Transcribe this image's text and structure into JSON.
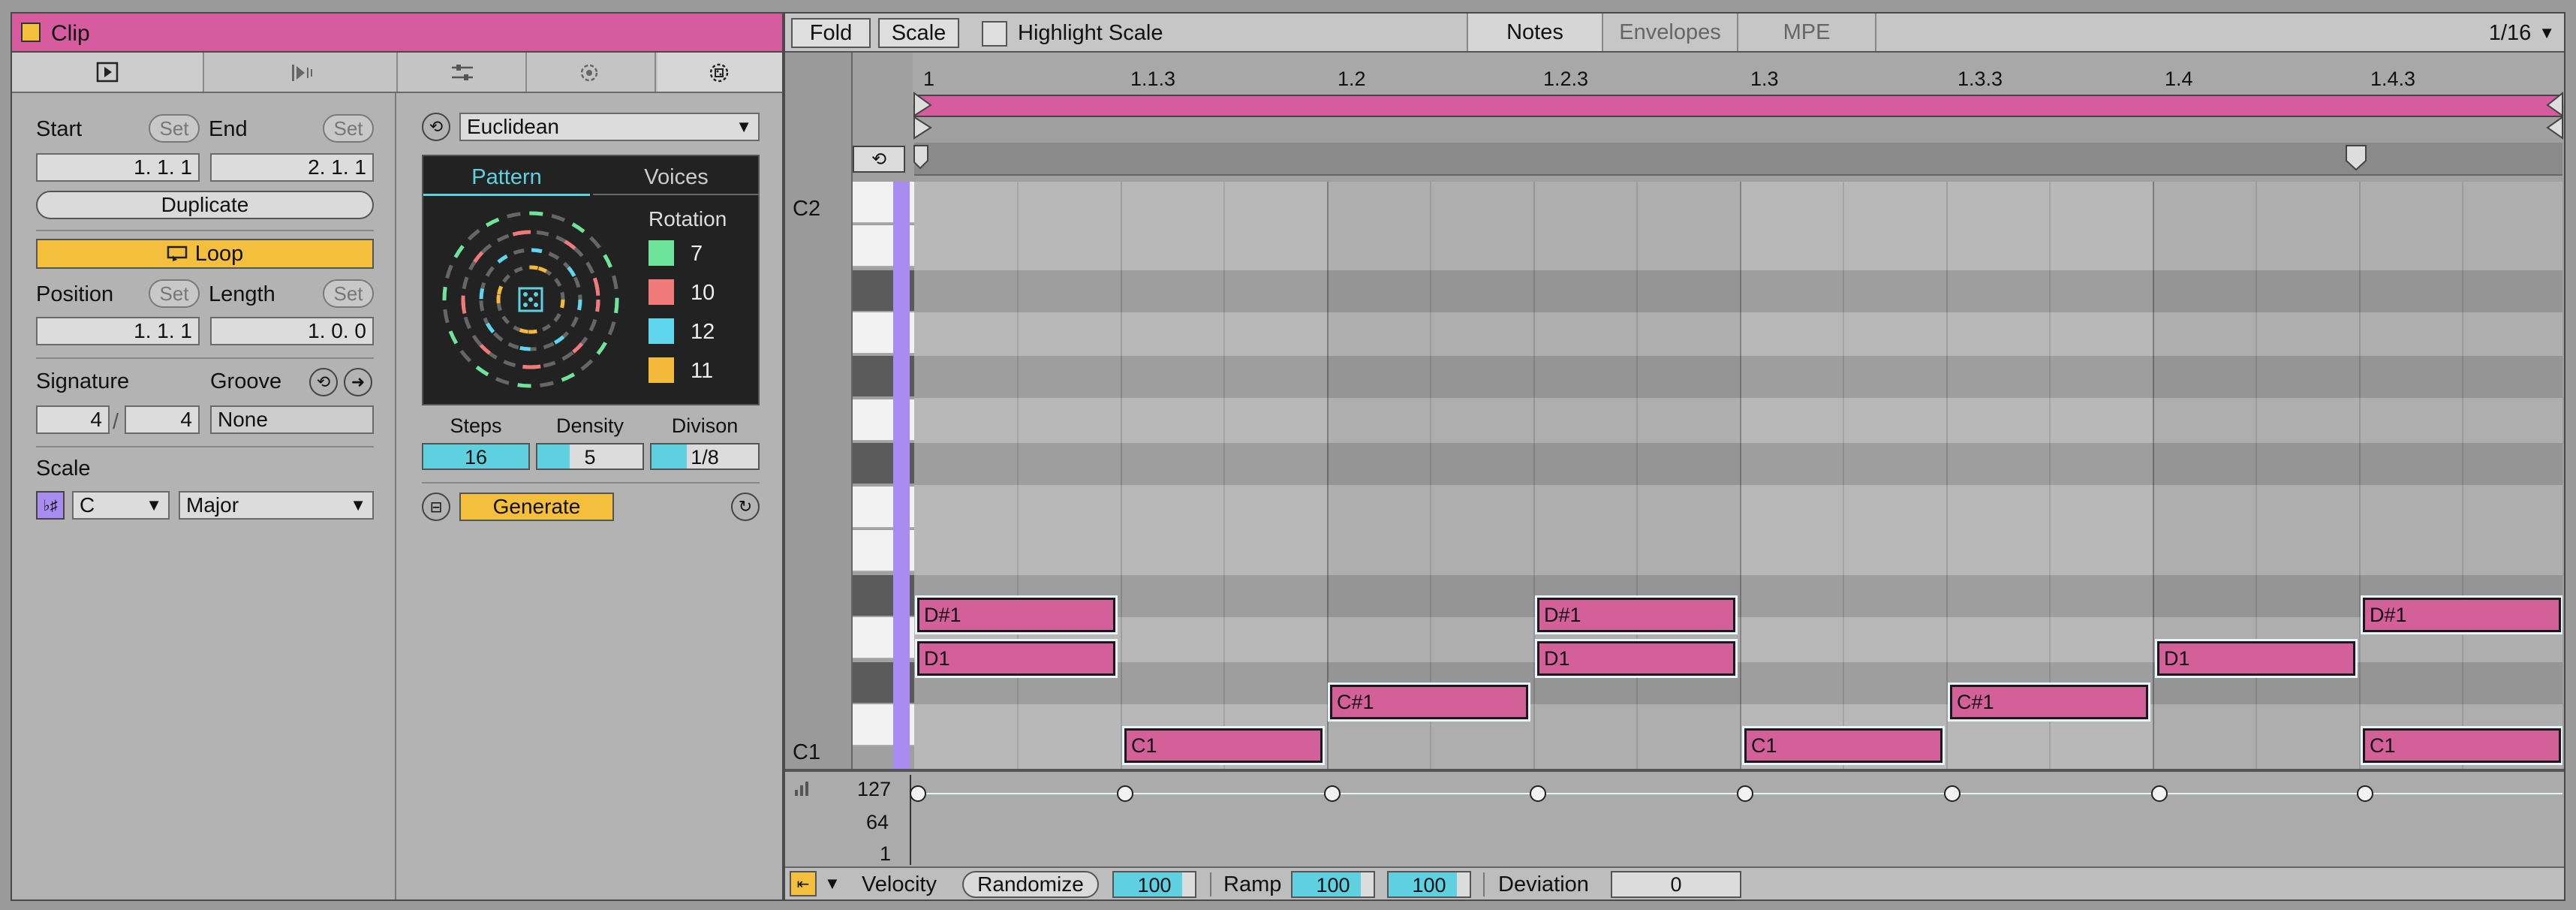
{
  "clip": {
    "title": "Clip",
    "start_label": "Start",
    "end_label": "End",
    "set": "Set",
    "start_value": "1.   1.   1",
    "end_value": "2.   1.   1",
    "duplicate": "Duplicate",
    "loop": "Loop",
    "position_label": "Position",
    "length_label": "Length",
    "position_value": "1.   1.   1",
    "length_value": "1.   0.   0",
    "signature_label": "Signature",
    "groove_label": "Groove",
    "sig_num": "4",
    "sig_den": "4",
    "groove_value": "None",
    "scale_label": "Scale",
    "scale_root": "C",
    "scale_mode": "Major"
  },
  "generator": {
    "type": "Euclidean",
    "tab_pattern": "Pattern",
    "tab_voices": "Voices",
    "rotation_label": "Rotation",
    "rotations": [
      {
        "value": "7",
        "color": "#6ee39a"
      },
      {
        "value": "10",
        "color": "#f07a7a"
      },
      {
        "value": "12",
        "color": "#5fd6ee"
      },
      {
        "value": "11",
        "color": "#f4b83a"
      }
    ],
    "steps_label": "Steps",
    "density_label": "Density",
    "division_label": "Divison",
    "steps_value": "16",
    "density_value": "5",
    "division_value": "1/8",
    "steps_fraction": 1.0,
    "density_fraction": 0.31,
    "division_fraction": 0.33,
    "generate": "Generate"
  },
  "toolbar": {
    "fold": "Fold",
    "scale": "Scale",
    "highlight_scale": "Highlight Scale",
    "tab_notes": "Notes",
    "tab_envelopes": "Envelopes",
    "tab_mpe": "MPE",
    "grid": "1/16"
  },
  "ruler": [
    "1",
    "1.1.3",
    "1.2",
    "1.2.3",
    "1.3",
    "1.3.3",
    "1.4",
    "1.4.3"
  ],
  "keys": {
    "top": "C2",
    "bottom": "C1"
  },
  "notes": [
    {
      "label": "D#1"
    },
    {
      "label": "D#1"
    },
    {
      "label": "D#1"
    },
    {
      "label": "D1"
    },
    {
      "label": "D1"
    },
    {
      "label": "D1"
    },
    {
      "label": "C#1"
    },
    {
      "label": "C#1"
    },
    {
      "label": "C1"
    },
    {
      "label": "C1"
    },
    {
      "label": "C1"
    }
  ],
  "velocity_lane": {
    "max": "127",
    "mid": "64",
    "min": "1"
  },
  "bottom": {
    "velocity_label": "Velocity",
    "randomize": "Randomize",
    "velocity_value": "100",
    "ramp_label": "Ramp",
    "ramp_start": "100",
    "ramp_end": "100",
    "deviation_label": "Deviation",
    "deviation_value": "0"
  },
  "colors": {
    "clip_header": "#d65b9f",
    "note": "#d4609a",
    "loop_bar": "#d65b9f",
    "loop_button": "#f4bf3c",
    "generate_button": "#f4bf3c",
    "accent_cyan": "#5fd0e0",
    "key_highlight": "#a88cf0"
  }
}
